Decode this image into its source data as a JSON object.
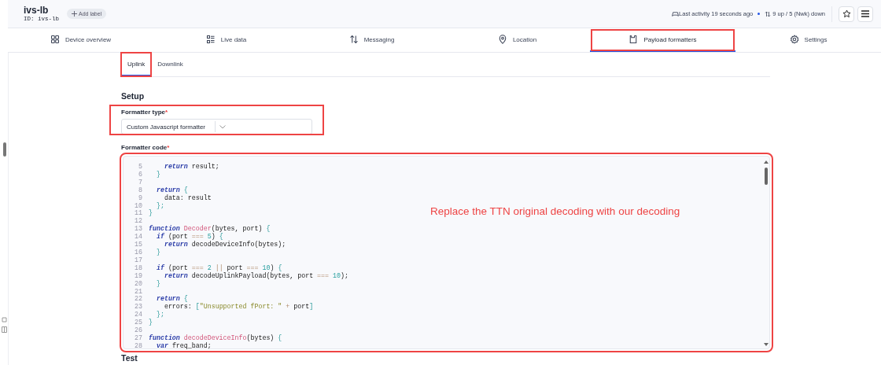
{
  "device": {
    "name": "ivs-lb",
    "id": "ID: ivs-lb",
    "add_label": "Add label"
  },
  "status": {
    "last_activity": "Last activity 19 seconds ago",
    "traffic": "9 up / 5 (Nwk) down"
  },
  "nav_tabs": [
    {
      "label": "Device overview",
      "kind": "overview",
      "selected": false,
      "highlighted": false
    },
    {
      "label": "Live data",
      "kind": "live",
      "selected": false,
      "highlighted": false
    },
    {
      "label": "Messaging",
      "kind": "messaging",
      "selected": false,
      "highlighted": false
    },
    {
      "label": "Location",
      "kind": "location",
      "selected": false,
      "highlighted": false
    },
    {
      "label": "Payload formatters",
      "kind": "payload",
      "selected": true,
      "highlighted": true
    },
    {
      "label": "Settings",
      "kind": "settings",
      "selected": false,
      "highlighted": false
    }
  ],
  "sub_tabs": [
    {
      "label": "Uplink",
      "selected": true,
      "highlighted": true
    },
    {
      "label": "Downlink",
      "selected": false,
      "highlighted": false
    }
  ],
  "setup": {
    "heading": "Setup",
    "formatter_type": {
      "label": "Formatter type",
      "required_mark": "*",
      "value": "Custom Javascript formatter",
      "highlighted": true
    },
    "formatter_code": {
      "label": "Formatter code",
      "required_mark": "*",
      "highlighted": true,
      "annotation": "Replace the TTN original decoding with our decoding",
      "lines": [
        {
          "n": "5",
          "segments": [
            {
              "kind": "keyword",
              "text": "    return"
            },
            {
              "kind": "plain",
              "text": " result;"
            }
          ]
        },
        {
          "n": "6",
          "segments": [
            {
              "kind": "bracket",
              "text": "  }"
            }
          ]
        },
        {
          "n": "7"
        },
        {
          "n": "8",
          "segments": [
            {
              "kind": "keyword",
              "text": "  return"
            },
            {
              "kind": "bracket",
              "text": " {"
            }
          ]
        },
        {
          "n": "9",
          "segments": [
            {
              "kind": "plain",
              "text": "    data: result"
            }
          ]
        },
        {
          "n": "10",
          "segments": [
            {
              "kind": "bracket",
              "text": "  };"
            }
          ]
        },
        {
          "n": "11",
          "segments": [
            {
              "kind": "bracket",
              "text": "}"
            }
          ]
        },
        {
          "n": "12"
        },
        {
          "n": "13",
          "segments": [
            {
              "kind": "keyword",
              "text": "function "
            },
            {
              "kind": "function",
              "text": "Decoder"
            },
            {
              "kind": "plain",
              "text": "(bytes, port) "
            },
            {
              "kind": "bracket",
              "text": "{"
            }
          ]
        },
        {
          "n": "14",
          "segments": [
            {
              "kind": "keyword",
              "text": "  if"
            },
            {
              "kind": "plain",
              "text": " (port "
            },
            {
              "kind": "operator",
              "text": "=== "
            },
            {
              "kind": "number",
              "text": "5"
            },
            {
              "kind": "plain",
              "text": ") "
            },
            {
              "kind": "bracket",
              "text": "{"
            }
          ]
        },
        {
          "n": "15",
          "segments": [
            {
              "kind": "keyword",
              "text": "    return"
            },
            {
              "kind": "plain",
              "text": " decodeDeviceInfo(bytes);"
            }
          ]
        },
        {
          "n": "16",
          "segments": [
            {
              "kind": "bracket",
              "text": "  }"
            }
          ]
        },
        {
          "n": "17"
        },
        {
          "n": "18",
          "segments": [
            {
              "kind": "keyword",
              "text": "  if"
            },
            {
              "kind": "plain",
              "text": " (port "
            },
            {
              "kind": "operator",
              "text": "=== "
            },
            {
              "kind": "number",
              "text": "2"
            },
            {
              "kind": "operator",
              "text": " || "
            },
            {
              "kind": "plain",
              "text": "port "
            },
            {
              "kind": "operator",
              "text": "=== "
            },
            {
              "kind": "number",
              "text": "10"
            },
            {
              "kind": "plain",
              "text": ") "
            },
            {
              "kind": "bracket",
              "text": "{"
            }
          ]
        },
        {
          "n": "19",
          "segments": [
            {
              "kind": "keyword",
              "text": "    return"
            },
            {
              "kind": "plain",
              "text": " decodeUplinkPayload(bytes, port "
            },
            {
              "kind": "operator",
              "text": "=== "
            },
            {
              "kind": "number",
              "text": "10"
            },
            {
              "kind": "plain",
              "text": ");"
            }
          ]
        },
        {
          "n": "20",
          "segments": [
            {
              "kind": "bracket",
              "text": "  }"
            }
          ]
        },
        {
          "n": "21"
        },
        {
          "n": "22",
          "segments": [
            {
              "kind": "keyword",
              "text": "  return"
            },
            {
              "kind": "bracket",
              "text": " {"
            }
          ]
        },
        {
          "n": "23",
          "segments": [
            {
              "kind": "plain",
              "text": "    errors: "
            },
            {
              "kind": "bracket",
              "text": "["
            },
            {
              "kind": "string",
              "text": "\"Unsupported fPort: \""
            },
            {
              "kind": "operator",
              "text": " + "
            },
            {
              "kind": "plain",
              "text": "port"
            },
            {
              "kind": "bracket",
              "text": "]"
            }
          ]
        },
        {
          "n": "24",
          "segments": [
            {
              "kind": "bracket",
              "text": "  };"
            }
          ]
        },
        {
          "n": "25",
          "segments": [
            {
              "kind": "bracket",
              "text": "}"
            }
          ]
        },
        {
          "n": "26"
        },
        {
          "n": "27",
          "segments": [
            {
              "kind": "keyword",
              "text": "function "
            },
            {
              "kind": "function",
              "text": "decodeDeviceInfo"
            },
            {
              "kind": "plain",
              "text": "(bytes) "
            },
            {
              "kind": "bracket",
              "text": "{"
            }
          ]
        },
        {
          "n": "28",
          "segments": [
            {
              "kind": "keyword",
              "text": "  var"
            },
            {
              "kind": "plain",
              "text": " freq_band;"
            }
          ]
        }
      ]
    }
  },
  "next_heading": "Test"
}
